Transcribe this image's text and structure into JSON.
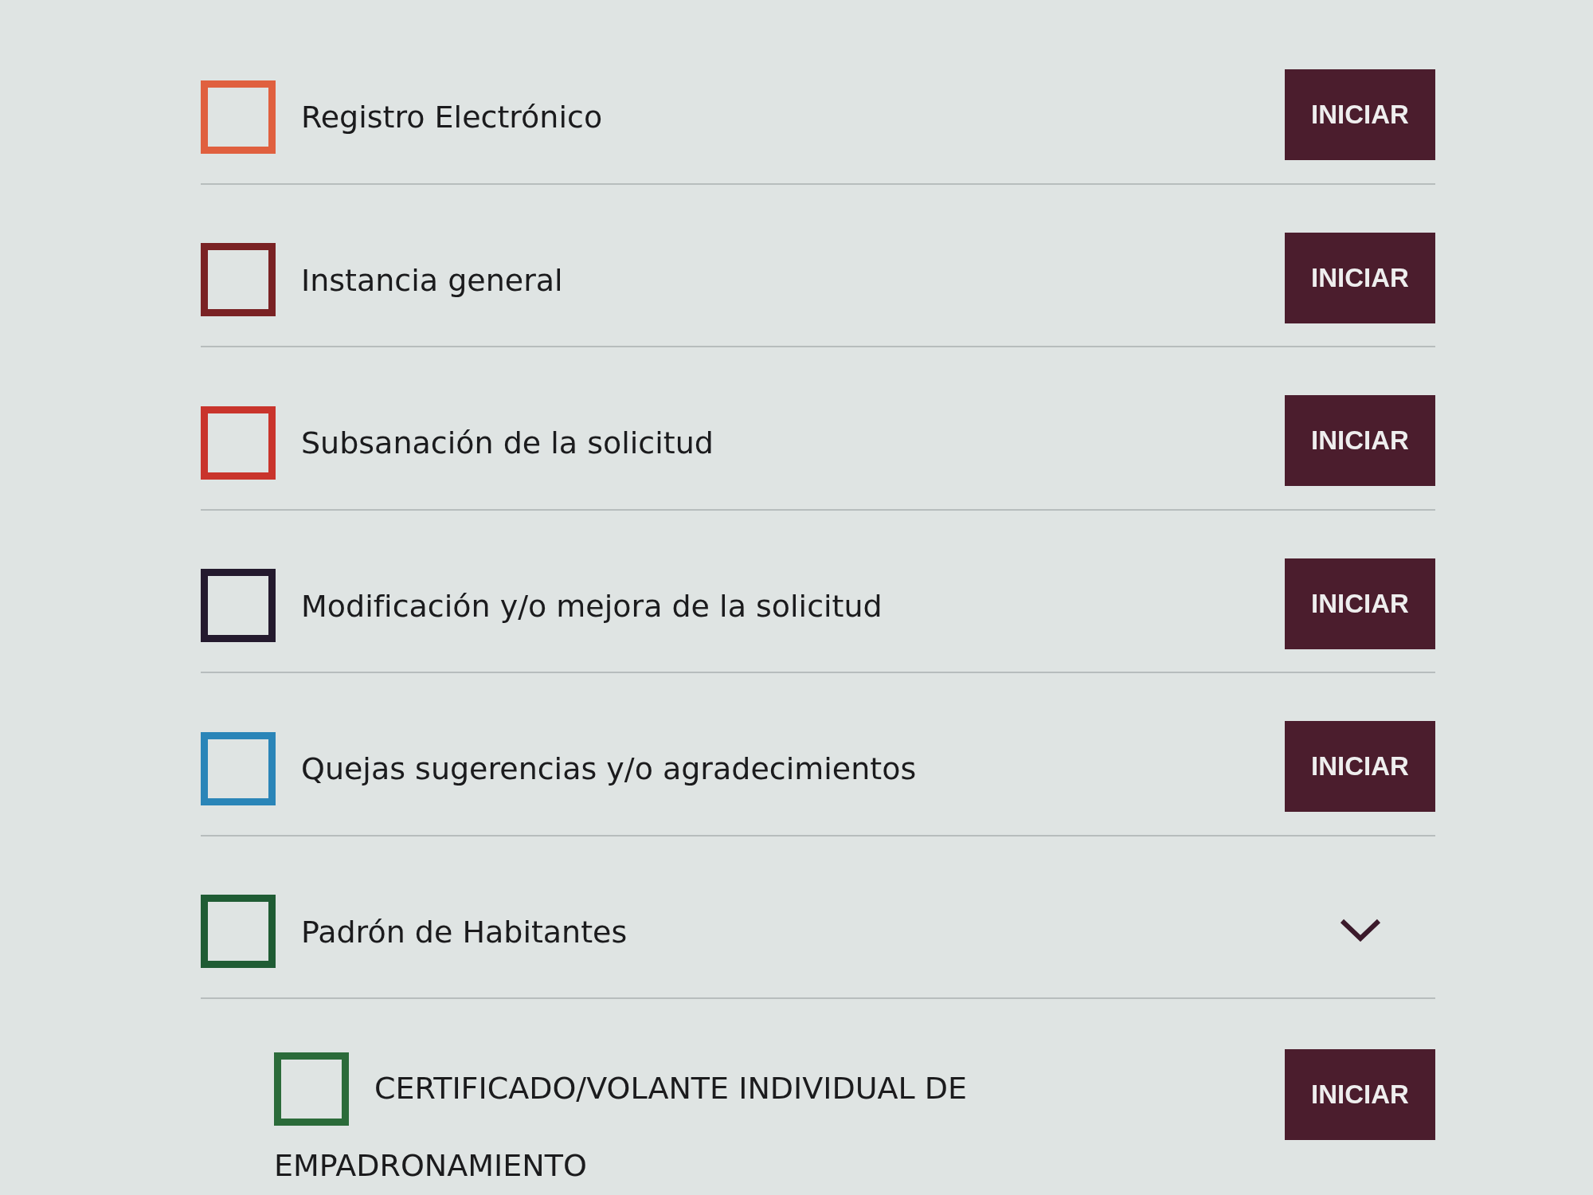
{
  "items": [
    {
      "kind": "procedure",
      "label": "Registro Electrónico",
      "color": "#e0603f",
      "action": "INICIAR"
    },
    {
      "kind": "procedure",
      "label": "Instancia general",
      "color": "#7a2224",
      "action": "INICIAR"
    },
    {
      "kind": "procedure",
      "label": "Subsanación de la solicitud",
      "color": "#c9342c",
      "action": "INICIAR"
    },
    {
      "kind": "procedure",
      "label": "Modificación y/o mejora de la solicitud",
      "color": "#241a2e",
      "action": "INICIAR"
    },
    {
      "kind": "procedure",
      "label": "Quejas sugerencias y/o agradecimientos",
      "color": "#2a85b8",
      "action": "INICIAR"
    },
    {
      "kind": "group",
      "label": "Padrón de Habitantes",
      "color": "#1f5c34",
      "expanded": true,
      "children": [
        {
          "kind": "procedure",
          "label": "CERTIFICADO/VOLANTE INDIVIDUAL DE EMPADRONAMIENTO",
          "color": "#2b6b3a",
          "action": "INICIAR"
        }
      ]
    }
  ]
}
